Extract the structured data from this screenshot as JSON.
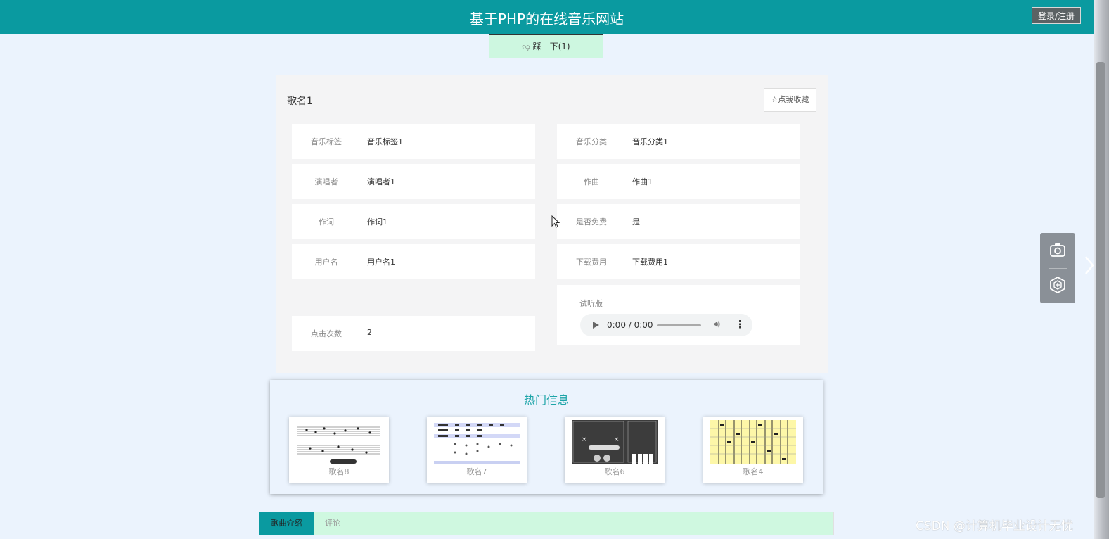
{
  "header": {
    "title": "基于PHP的在线音乐网站",
    "login_label": "登录/注册"
  },
  "dislike_label": "踩一下(1)",
  "song": {
    "name": "歌名1",
    "favorite_label": "☆点我收藏",
    "fields_left": [
      {
        "label": "音乐标签",
        "value": "音乐标签1"
      },
      {
        "label": "演唱者",
        "value": "演唱者1"
      },
      {
        "label": "作词",
        "value": "作词1"
      },
      {
        "label": "用户名",
        "value": "用户名1"
      },
      {
        "label": "点击次数",
        "value": "2"
      }
    ],
    "fields_right": [
      {
        "label": "音乐分类",
        "value": "音乐分类1"
      },
      {
        "label": "作曲",
        "value": "作曲1"
      },
      {
        "label": "是否免费",
        "value": "是"
      },
      {
        "label": "下载费用",
        "value": "下载费用1"
      }
    ],
    "audio": {
      "label": "试听版",
      "time": "0:00 / 0:00"
    }
  },
  "hot": {
    "title": "热门信息",
    "items": [
      {
        "name": "歌名8"
      },
      {
        "name": "歌名7"
      },
      {
        "name": "歌名6"
      },
      {
        "name": "歌名4"
      }
    ]
  },
  "tabs": [
    {
      "label": "歌曲介绍"
    },
    {
      "label": "评论"
    }
  ],
  "watermark": "CSDN @计算机毕业设计无忧",
  "colors": {
    "header": "#0a9aa0",
    "accent": "#1da4a8",
    "dislike_bg": "#cdf7e0",
    "tabs_bg": "#cff8e0"
  },
  "icons": {
    "side_tools": [
      "camera-icon",
      "hexagon-plus-icon",
      "chevron-right-icon"
    ]
  }
}
